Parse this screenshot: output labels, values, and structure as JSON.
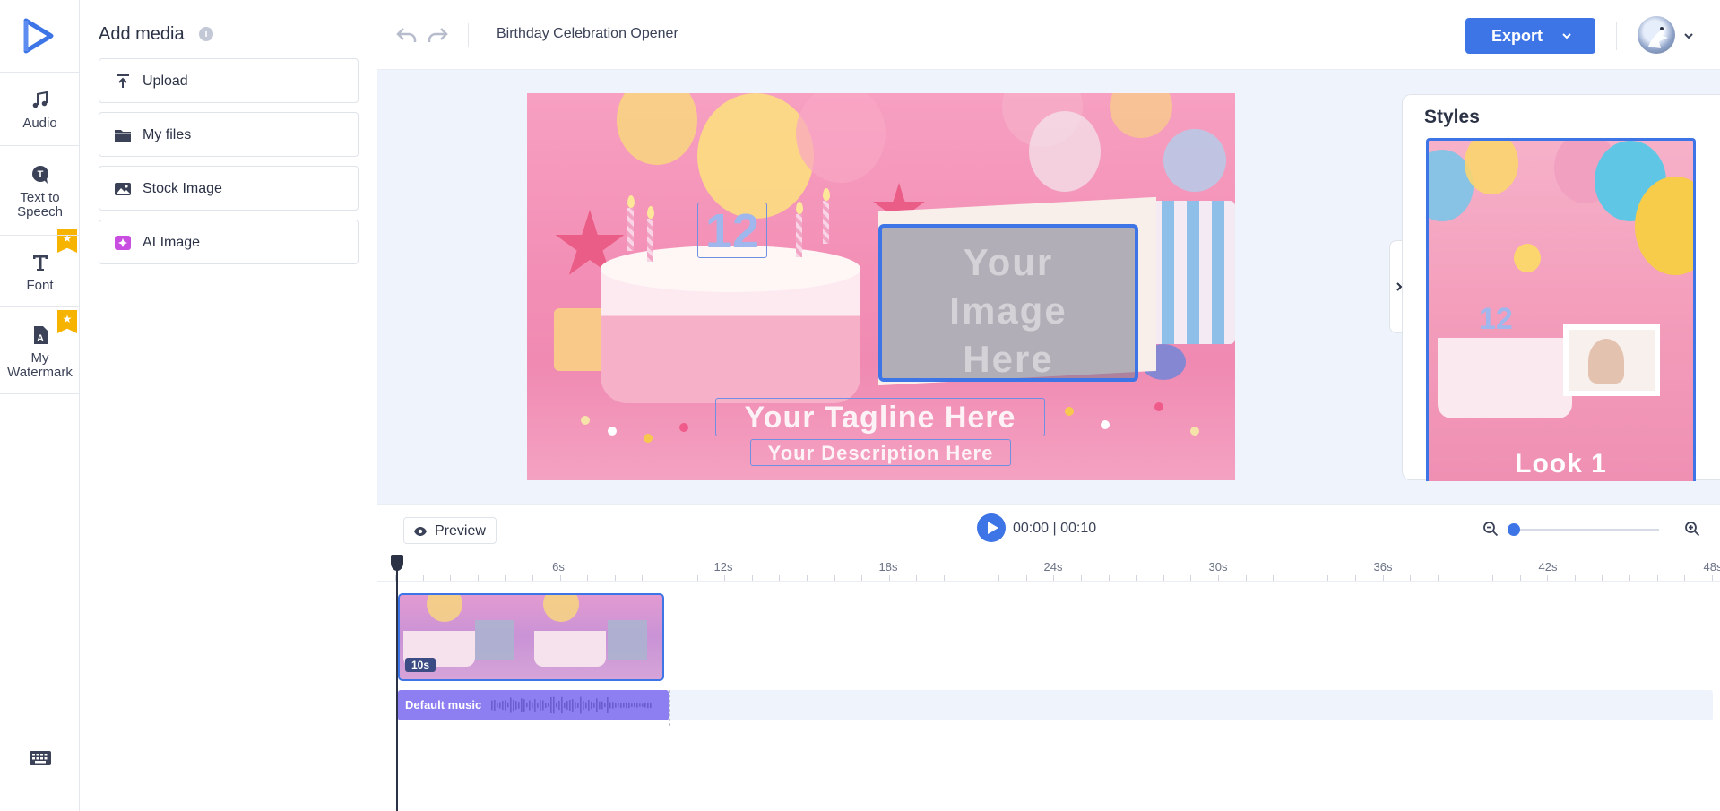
{
  "app": {
    "project_title": "Birthday Celebration Opener",
    "accent_color": "#3d74e6"
  },
  "rail": {
    "items": [
      {
        "label": "Audio",
        "icon": "music-note-icon",
        "premium": false
      },
      {
        "label": "Text to\nSpeech",
        "icon": "speech-bubble-icon",
        "premium": true
      },
      {
        "label": "Font",
        "icon": "font-t-icon",
        "premium": false
      },
      {
        "label": "My\nWatermark",
        "icon": "watermark-icon",
        "premium": true
      }
    ],
    "bottom_icon": "keyboard-icon"
  },
  "media": {
    "title": "Add media",
    "info_icon": "info-icon",
    "buttons": [
      {
        "label": "Upload",
        "icon": "upload-icon"
      },
      {
        "label": "My files",
        "icon": "folder-icon"
      },
      {
        "label": "Stock Image",
        "icon": "image-icon"
      },
      {
        "label": "AI Image",
        "icon": "ai-sparkle-icon"
      }
    ]
  },
  "topbar": {
    "export_label": "Export"
  },
  "canvas": {
    "number_text": "12",
    "image_placeholder": "Your\nImage\nHere",
    "tagline": "Your Tagline Here",
    "description": "Your Description Here"
  },
  "styles": {
    "title": "Styles",
    "cards": [
      {
        "label": "Look 1",
        "selected": true
      }
    ]
  },
  "timeline": {
    "preview_label": "Preview",
    "current_time": "00:00",
    "total_time": "00:10",
    "time_readout": "00:00 | 00:10",
    "ruler_labels": [
      "6s",
      "12s",
      "18s",
      "24s",
      "30s",
      "36s",
      "42s",
      "48s"
    ],
    "clip_duration": "10s",
    "music_label": "Default music",
    "music_color": "#8d7ef2"
  }
}
